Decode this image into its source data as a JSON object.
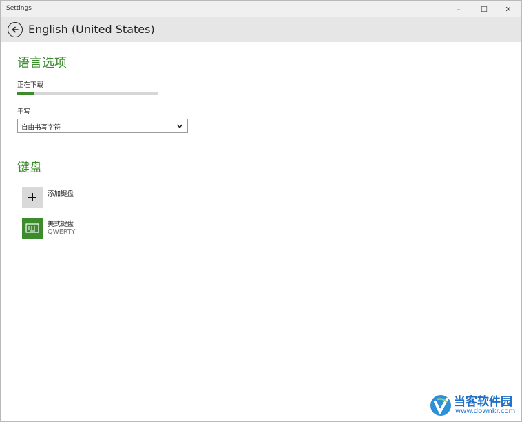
{
  "window": {
    "title": "Settings",
    "controls": {
      "minimize": "–",
      "maximize": "☐",
      "close": "✕"
    }
  },
  "header": {
    "title": "English (United States)"
  },
  "language_options": {
    "title": "语言选项",
    "download_status": "正在下载",
    "download_progress": 0.12,
    "handwriting_label": "手写",
    "handwriting_value": "自由书写字符"
  },
  "keyboards": {
    "title": "键盘",
    "add_label": "添加键盘",
    "items": [
      {
        "name": "美式键盘",
        "layout": "QWERTY"
      }
    ]
  },
  "watermark": {
    "text": "当客软件园",
    "url": "www.downkr.com"
  },
  "colors": {
    "accent": "#3c8c2e",
    "header_bg": "#e6e6e6",
    "titlebar_bg": "#f0f0f0"
  }
}
